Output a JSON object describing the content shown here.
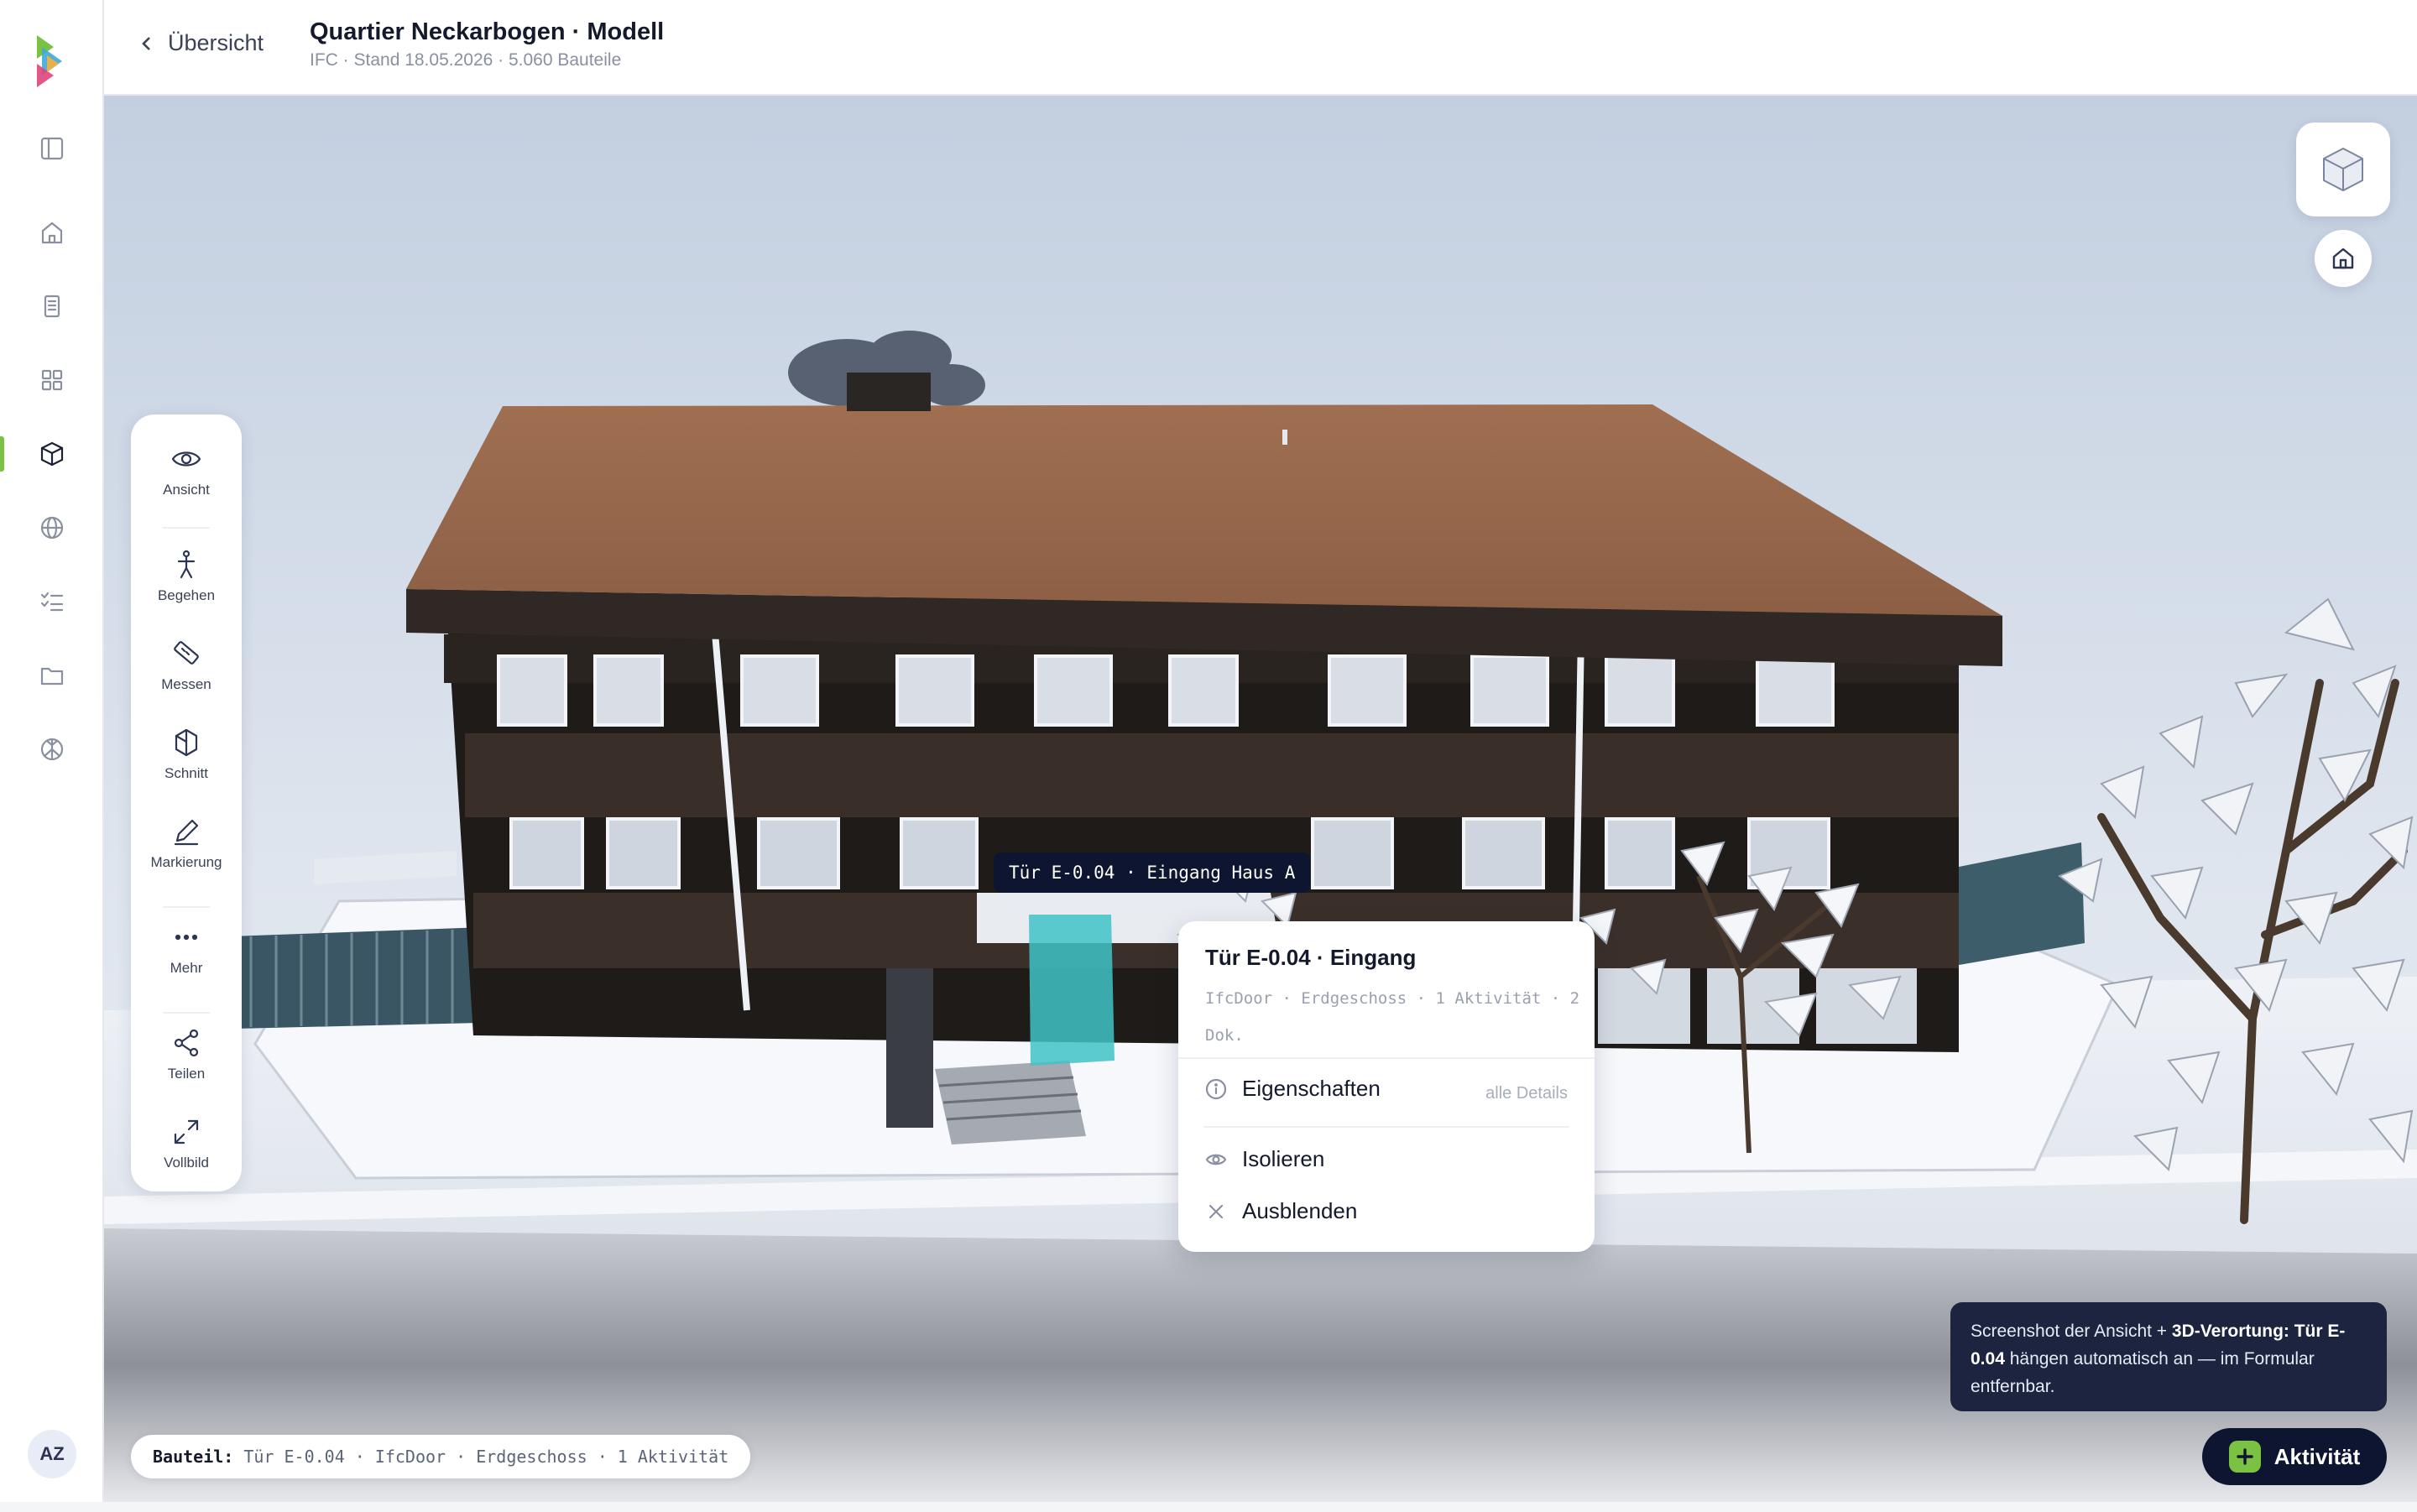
{
  "rail": {
    "items": [
      "sidebar-toggle",
      "home",
      "documents",
      "dashboard",
      "model",
      "map",
      "tasks",
      "files",
      "network"
    ],
    "active": "model",
    "avatar": "AZ",
    "accent": "#7cc242"
  },
  "header": {
    "back_label": "Übersicht",
    "title": "Quartier Neckarbogen · Modell",
    "subtitle": "IFC · Stand 18.05.2026 · 5.060 Bauteile"
  },
  "tools": [
    {
      "label": "Ansicht",
      "icon": "eye-icon"
    },
    {
      "label": "Begehen",
      "icon": "walk-icon"
    },
    {
      "label": "Messen",
      "icon": "ruler-icon"
    },
    {
      "label": "Schnitt",
      "icon": "section-icon"
    },
    {
      "label": "Markierung",
      "icon": "pen-icon"
    },
    {
      "label": "Mehr",
      "icon": "more-icon"
    },
    {
      "label": "Teilen",
      "icon": "share-icon"
    },
    {
      "label": "Vollbild",
      "icon": "fullscreen-icon"
    }
  ],
  "element_label": "Tür E-0.04 · Eingang Haus A",
  "popup": {
    "title": "Tür E-0.04 · Eingang",
    "meta": "IfcDoor · Erdgeschoss · 1 Aktivität · 2 Dok.",
    "properties_label": "Eigenschaften",
    "details_link": "alle Details",
    "isolate_label": "Isolieren",
    "hide_label": "Ausblenden"
  },
  "status": {
    "key": "Bauteil:",
    "element": "Tür E-0.04",
    "details": "IfcDoor · Erdgeschoss · 1 Aktivität"
  },
  "infotip": {
    "prefix": "Screenshot der Ansicht + ",
    "bold": "3D-Verortung: Tür E-0.04",
    "suffix": " hängen automatisch an — im Formular entfernbar."
  },
  "action_button": "Aktivität",
  "colors": {
    "roof": "#9a6a4c",
    "facade": "#2c2520",
    "selection": "#3fc3c7",
    "dark": "#0e1530"
  }
}
